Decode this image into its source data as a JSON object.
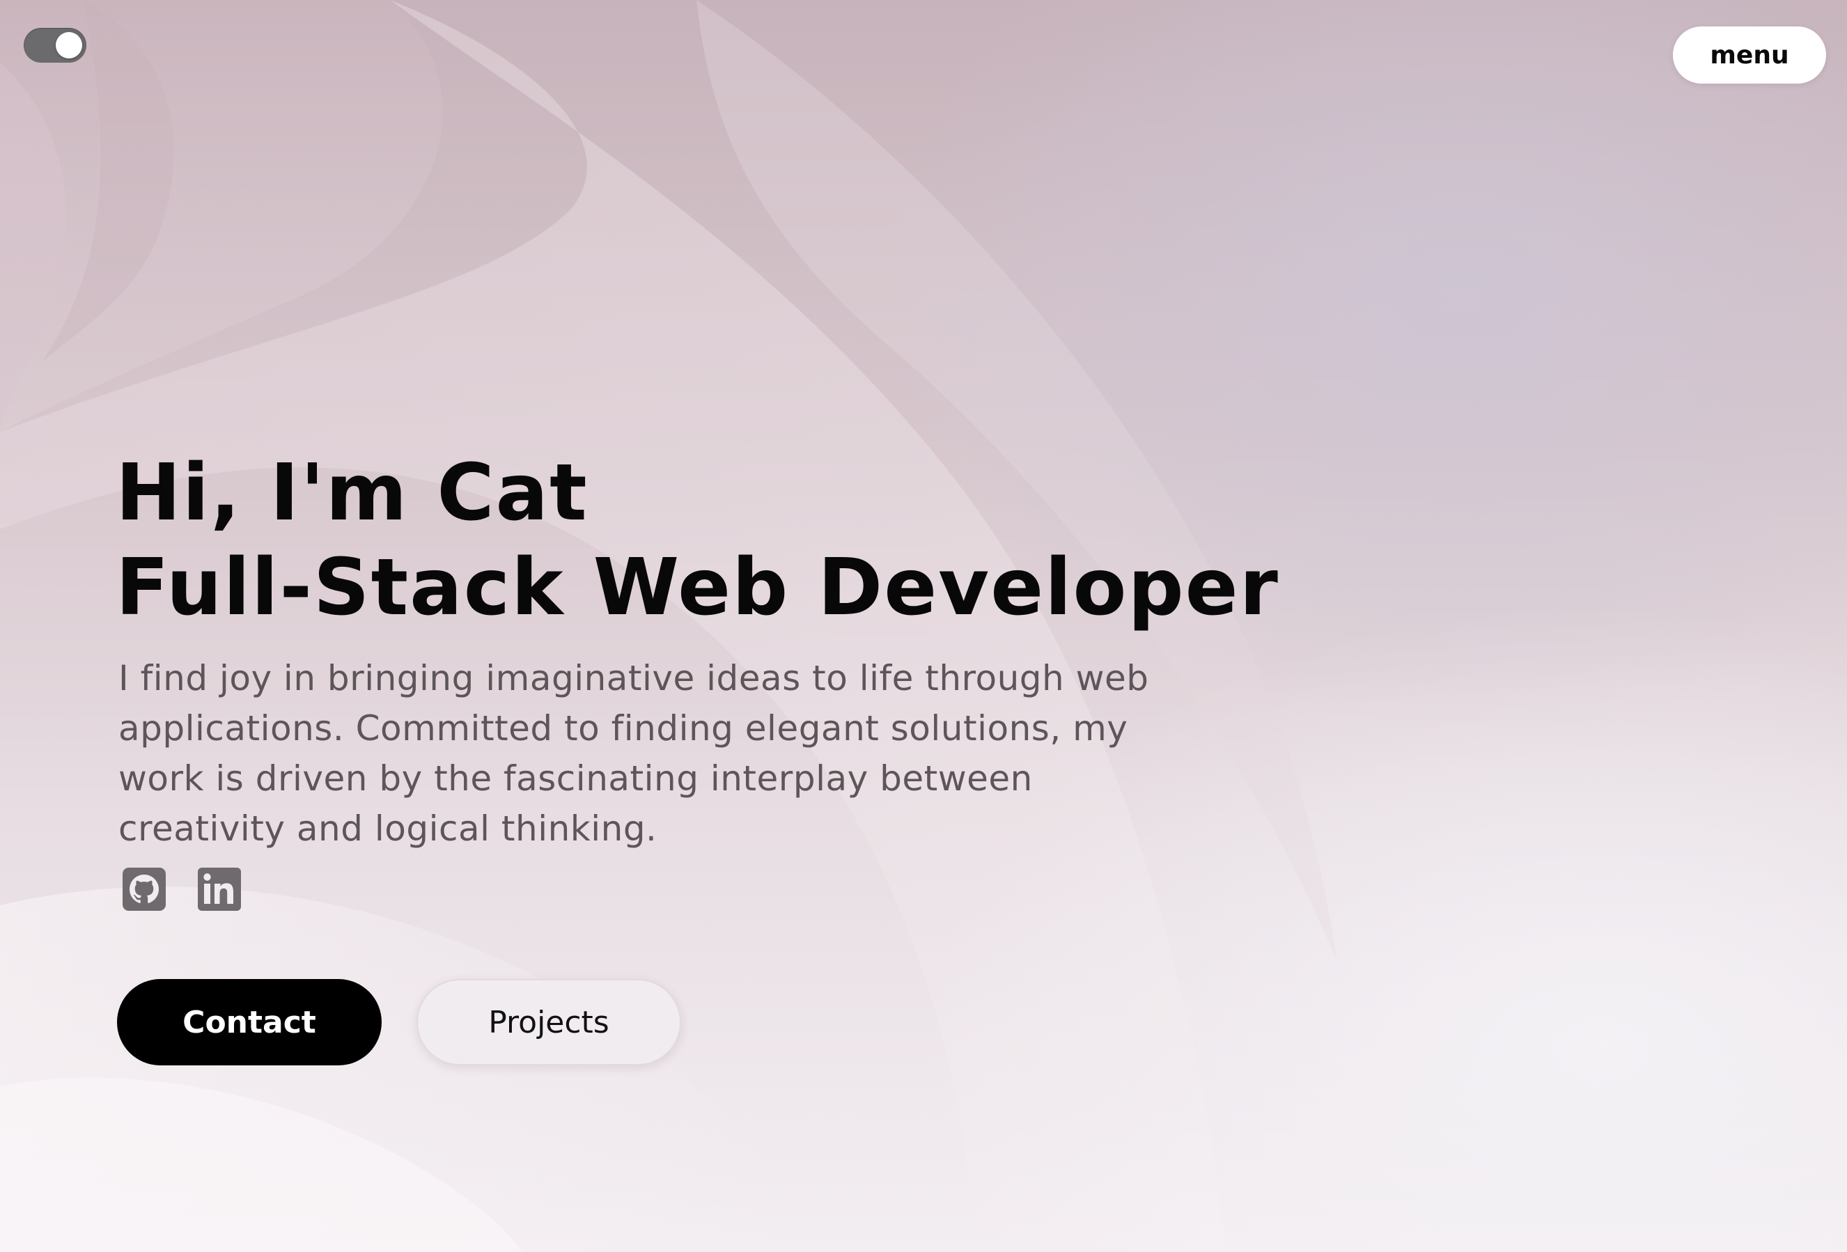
{
  "header": {
    "theme_toggle": {
      "state": "on",
      "icon": "toggle-switch-icon"
    },
    "menu_label": "menu"
  },
  "hero": {
    "greeting": "Hi, I'm Cat",
    "role": "Full-Stack Web Developer",
    "description": "I find joy in bringing imaginative ideas to life through web applications. Committed to finding elegant solutions, my work is driven by the fascinating interplay between creativity and logical thinking.",
    "socials": [
      {
        "icon": "github-icon"
      },
      {
        "icon": "linkedin-icon"
      }
    ],
    "primary_action": "Contact",
    "secondary_action": "Projects"
  },
  "colors": {
    "background_top": "#c7b3bb",
    "background_bottom": "#f3eef2",
    "primary_button": "#000000",
    "text_primary": "#080808",
    "text_muted": "#5d5559",
    "icon_gray": "#6f6a6d"
  }
}
